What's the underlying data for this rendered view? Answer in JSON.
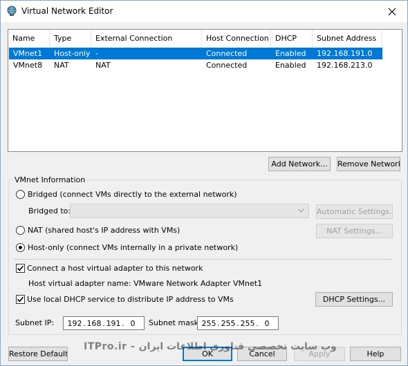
{
  "window": {
    "title": "Virtual Network Editor",
    "close_glyph": "✕"
  },
  "table": {
    "columns": [
      "Name",
      "Type",
      "External Connection",
      "Host Connection",
      "DHCP",
      "Subnet Address"
    ],
    "rows": [
      {
        "name": "VMnet1",
        "type": "Host-only",
        "external": "-",
        "host": "Connected",
        "dhcp": "Enabled",
        "subnet": "192.168.191.0",
        "selected": true
      },
      {
        "name": "VMnet8",
        "type": "NAT",
        "external": "NAT",
        "host": "Connected",
        "dhcp": "Enabled",
        "subnet": "192.168.213.0",
        "selected": false
      }
    ]
  },
  "buttons": {
    "add_network": "Add Network...",
    "remove_network": "Remove Network",
    "automatic_settings": "Automatic Settings...",
    "nat_settings": "NAT Settings...",
    "dhcp_settings": "DHCP Settings...",
    "restore_defaults": "Restore Defaults",
    "ok": "OK",
    "cancel": "Cancel",
    "apply": "Apply",
    "help": "Help"
  },
  "vmnet_info": {
    "group_label": "VMnet Information",
    "bridged_label": "Bridged (connect VMs directly to the external network)",
    "bridged_to_label": "Bridged to:",
    "bridged_to_value": "",
    "nat_label": "NAT (shared host's IP address with VMs)",
    "hostonly_label": "Host-only (connect VMs internally in a private network)",
    "selected_mode": "host-only",
    "connect_adapter_label": "Connect a host virtual adapter to this network",
    "connect_adapter_checked": true,
    "adapter_name_text": "Host virtual adapter name: VMware Network Adapter VMnet1",
    "dhcp_label": "Use local DHCP service to distribute IP address to VMs",
    "dhcp_checked": true,
    "subnet_ip_label": "Subnet IP:",
    "subnet_ip": [
      "192",
      "168",
      "191",
      "0"
    ],
    "subnet_mask_label": "Subnet mask:",
    "subnet_mask": [
      "255",
      "255",
      "255",
      "0"
    ]
  },
  "watermark_text": "ITPro.ir - وب سایت تخصصی فناوری اطلاعات ایران",
  "colors": {
    "selection": "#0078d7",
    "default_button_border": "#0078d7",
    "dialog_bg": "#f0f0f0"
  }
}
